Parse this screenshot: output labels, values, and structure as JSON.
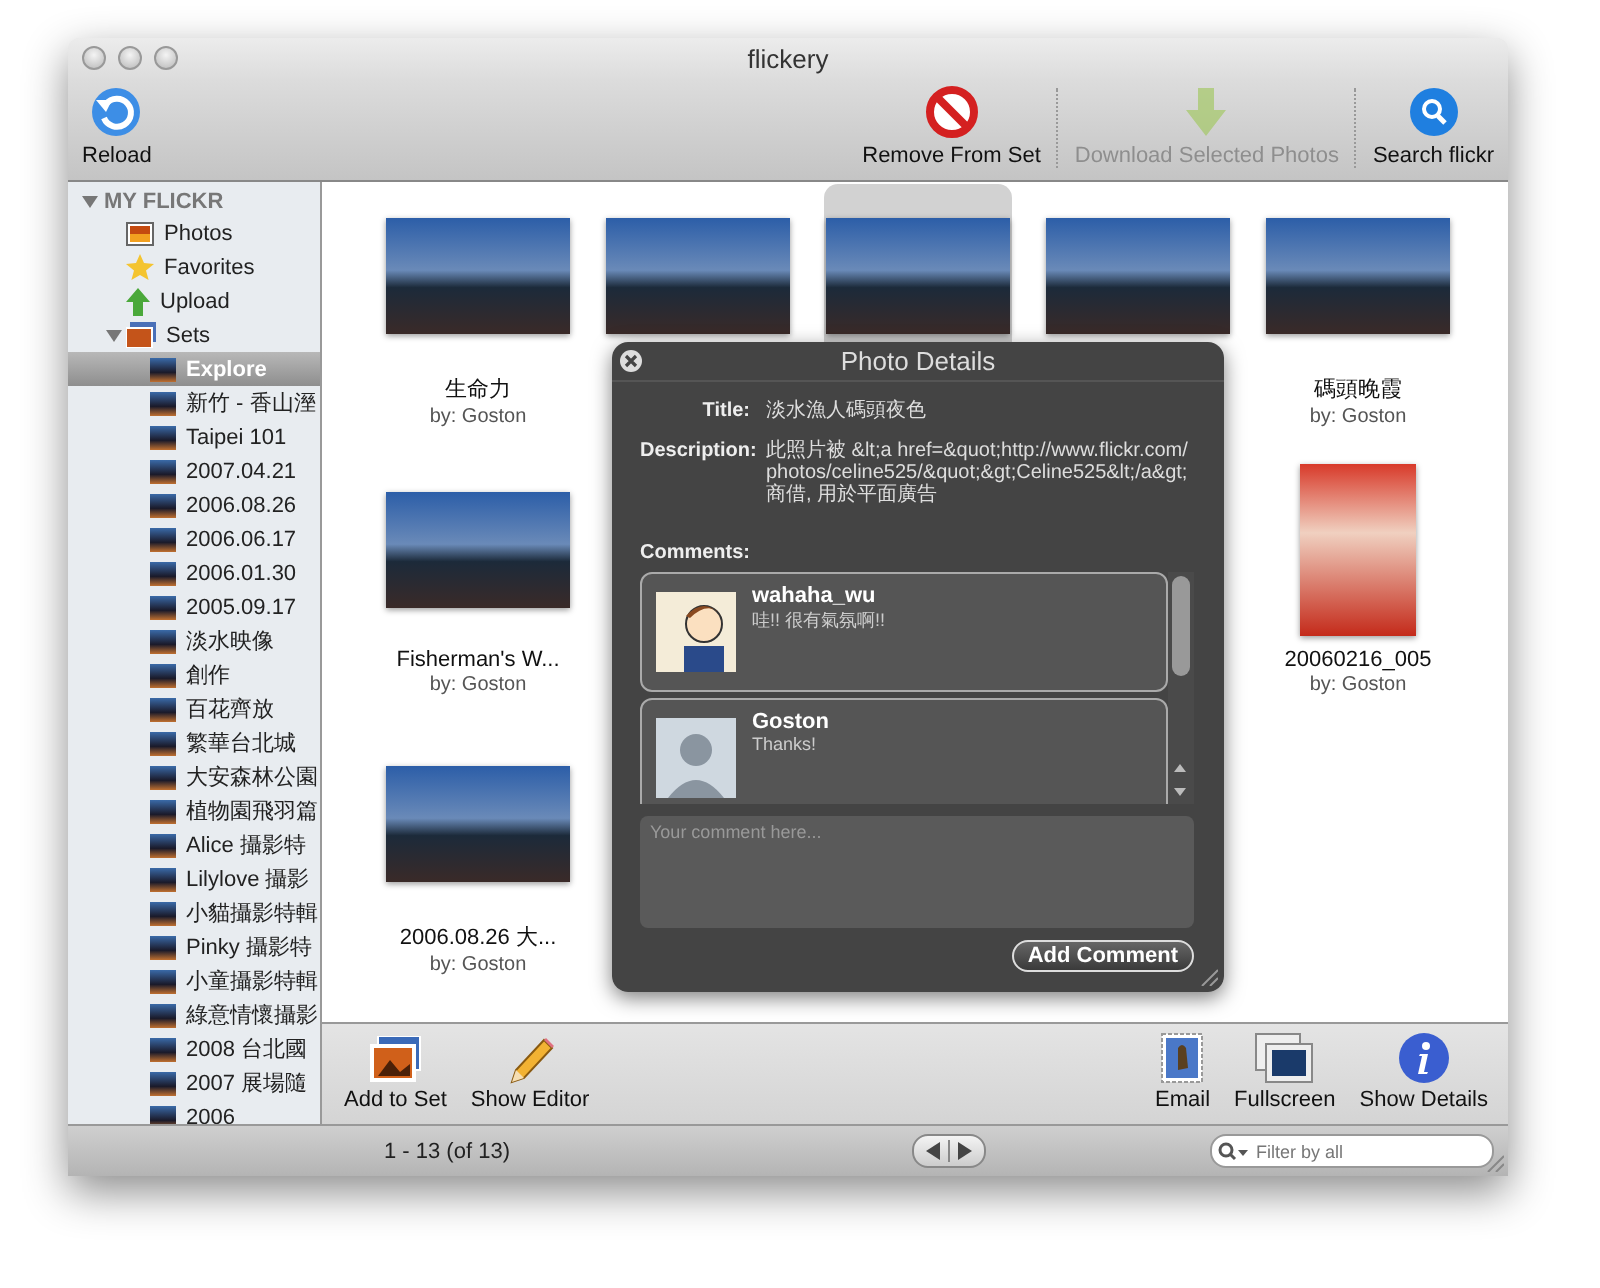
{
  "window": {
    "title": "flickery"
  },
  "toolbar": [
    {
      "label": "Reload",
      "kind": "reload",
      "disabled": false
    },
    {
      "label": "Remove From Set",
      "kind": "remove",
      "disabled": false
    },
    {
      "label": "Download Selected Photos",
      "kind": "download",
      "disabled": true
    },
    {
      "label": "Search flickr",
      "kind": "search",
      "disabled": false
    }
  ],
  "sidebar": {
    "label": "MY FLICKR",
    "expanded": true,
    "items": [
      {
        "label": "Photos",
        "kind": "photos"
      },
      {
        "label": "Favorites",
        "kind": "favorites"
      },
      {
        "label": "Upload",
        "kind": "upload"
      },
      {
        "label": "Sets",
        "kind": "sets",
        "expanded": true,
        "children": [
          {
            "label": "Explore",
            "selected": true
          },
          {
            "label": "新竹 - 香山溼",
            "selected": false
          },
          {
            "label": "Taipei 101",
            "selected": false
          },
          {
            "label": "2007.04.21",
            "selected": false
          },
          {
            "label": "2006.08.26",
            "selected": false
          },
          {
            "label": "2006.06.17",
            "selected": false
          },
          {
            "label": "2006.01.30",
            "selected": false
          },
          {
            "label": "2005.09.17",
            "selected": false
          },
          {
            "label": "淡水映像",
            "selected": false
          },
          {
            "label": "創作",
            "selected": false
          },
          {
            "label": "百花齊放",
            "selected": false
          },
          {
            "label": "繁華台北城",
            "selected": false
          },
          {
            "label": "大安森林公園",
            "selected": false
          },
          {
            "label": "植物園飛羽篇",
            "selected": false
          },
          {
            "label": "Alice 攝影特",
            "selected": false
          },
          {
            "label": "Lilylove 攝影",
            "selected": false
          },
          {
            "label": "小貓攝影特輯",
            "selected": false
          },
          {
            "label": "Pinky 攝影特",
            "selected": false
          },
          {
            "label": "小童攝影特輯",
            "selected": false
          },
          {
            "label": "綠意情懷攝影",
            "selected": false
          },
          {
            "label": "2008 台北國",
            "selected": false
          },
          {
            "label": "2007 展場隨",
            "selected": false
          },
          {
            "label": "2006",
            "selected": false
          }
        ]
      }
    ]
  },
  "photos": [
    {
      "kind": "landscape",
      "selected": false,
      "title": "生命力",
      "byline": "by: Goston"
    },
    {
      "kind": "landscape",
      "selected": false
    },
    {
      "kind": "landscape",
      "selected": true
    },
    {
      "kind": "landscape",
      "selected": false
    },
    {
      "kind": "landscape",
      "selected": false,
      "title": "碼頭晚霞",
      "byline": "by: Goston"
    },
    {
      "kind": "landscape",
      "selected": false,
      "title": "Fisherman's W...",
      "byline": "by: Goston"
    },
    {
      "kind": "hidden"
    },
    {
      "kind": "hidden"
    },
    {
      "kind": "hidden"
    },
    {
      "kind": "portrait",
      "selected": false,
      "title": "20060216_005",
      "byline": "by: Goston"
    },
    {
      "kind": "landscape",
      "selected": false,
      "title": "2006.08.26 大...",
      "byline": "by: Goston"
    },
    {
      "kind": "hidden"
    },
    {
      "kind": "hidden"
    }
  ],
  "details": {
    "title": "Photo Details",
    "fields": [
      {
        "label": "Title:",
        "value": "淡水漁人碼頭夜色"
      },
      {
        "label": "Description:",
        "value": "此照片被 &lt;a href=&quot;http://www.flickr.com/photos/celine525/&quot;&gt;Celine525&lt;/a&gt; 商借, 用於平面廣告"
      }
    ],
    "comments_label": "Comments:",
    "comments": [
      {
        "author": "wahaha_wu",
        "text": "哇!! 很有氣氛啊!!",
        "kind": "cartoon"
      },
      {
        "author": "Goston",
        "text": "Thanks!",
        "kind": "person"
      }
    ],
    "comment_field": {
      "placeholder": "Your comment here..."
    },
    "button": "Add Comment"
  },
  "bottom_toolbar": {
    "left": [
      {
        "label": "Add to Set",
        "kind": "photos"
      },
      {
        "label": "Show Editor",
        "kind": "pencil"
      }
    ],
    "right": [
      {
        "label": "Email",
        "kind": "stamp"
      },
      {
        "label": "Fullscreen",
        "kind": "screens"
      },
      {
        "label": "Show Details",
        "kind": "info"
      }
    ]
  },
  "status_bar": {
    "count": "1 - 13 (of 13)",
    "filter": {
      "placeholder": "Filter by all"
    }
  }
}
